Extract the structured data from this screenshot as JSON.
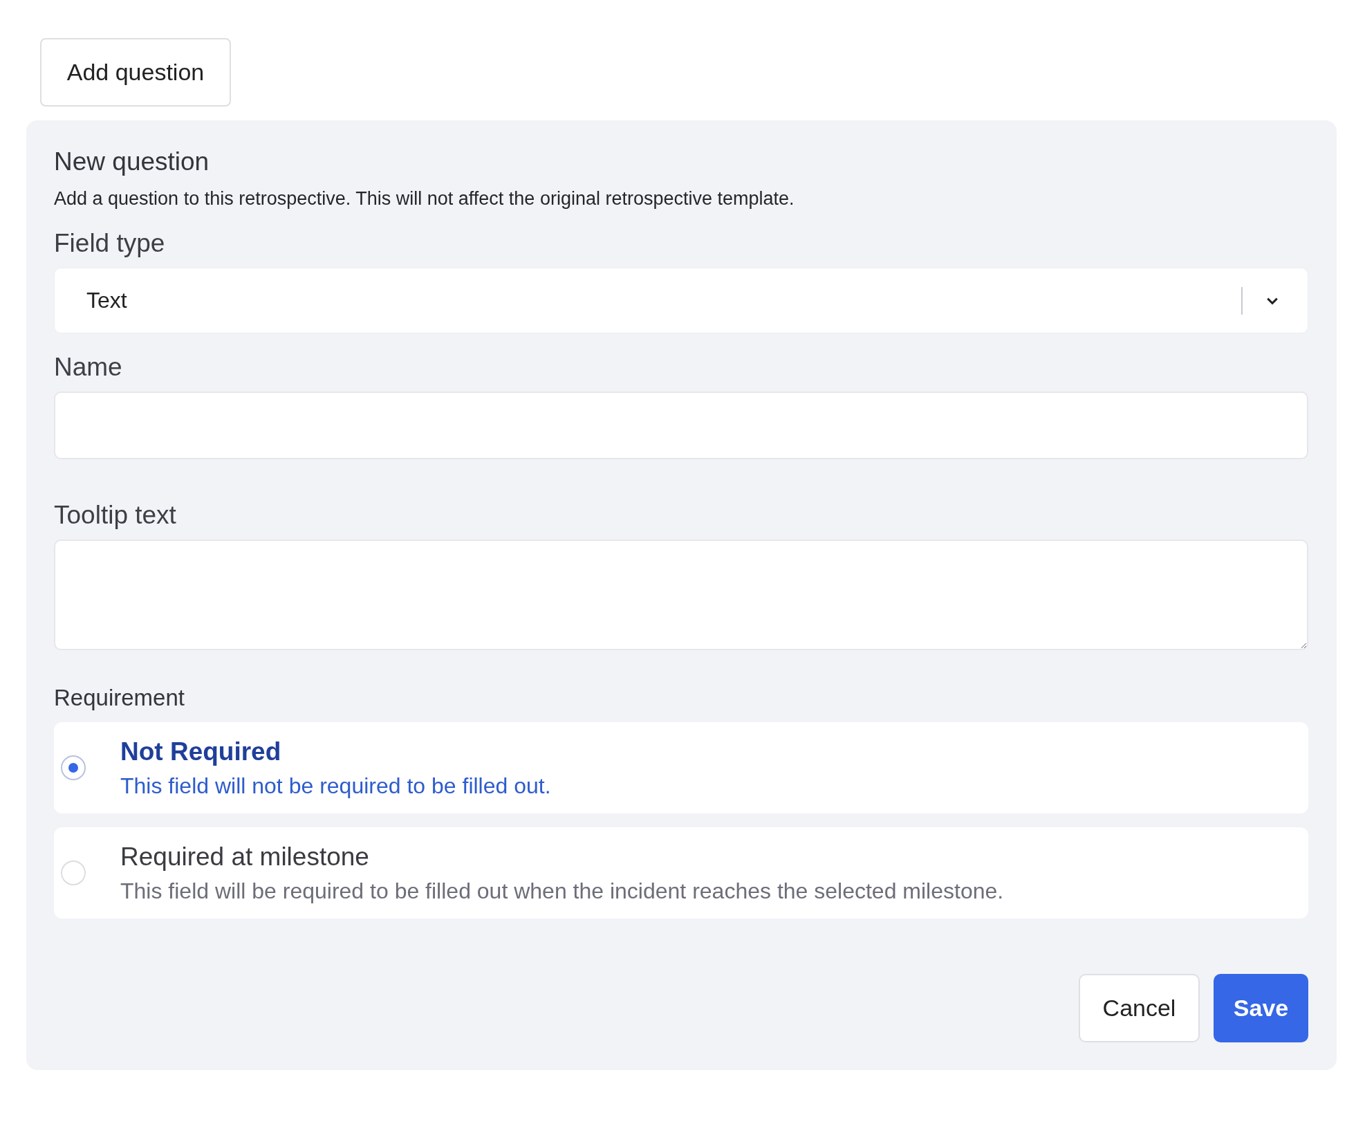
{
  "add_button": {
    "label": "Add question"
  },
  "panel": {
    "title": "New question",
    "description": "Add a question to this retrospective. This will not affect the original retrospective template.",
    "field_type": {
      "label": "Field type",
      "value": "Text"
    },
    "name": {
      "label": "Name"
    },
    "tooltip": {
      "label": "Tooltip text"
    },
    "requirement": {
      "label": "Requirement",
      "options": [
        {
          "title": "Not Required",
          "description": "This field will not be required to be filled out.",
          "selected": true
        },
        {
          "title": "Required at milestone",
          "description": "This field will be required to be filled out when the incident reaches the selected milestone.",
          "selected": false
        }
      ]
    },
    "buttons": [
      {
        "label": "Cancel",
        "kind": "secondary"
      },
      {
        "label": "Save",
        "kind": "primary"
      }
    ]
  }
}
